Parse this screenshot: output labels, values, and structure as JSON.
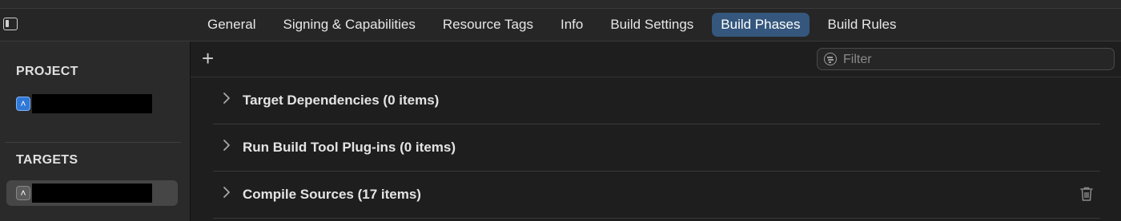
{
  "tabs": [
    {
      "label": "General"
    },
    {
      "label": "Signing & Capabilities"
    },
    {
      "label": "Resource Tags"
    },
    {
      "label": "Info"
    },
    {
      "label": "Build Settings"
    },
    {
      "label": "Build Phases",
      "active": true
    },
    {
      "label": "Build Rules"
    }
  ],
  "sidebar": {
    "project_header": "PROJECT",
    "targets_header": "TARGETS"
  },
  "toolbar": {
    "add_symbol": "+",
    "filter_placeholder": "Filter"
  },
  "phases": [
    {
      "label": "Target Dependencies (0 items)"
    },
    {
      "label": "Run Build Tool Plug-ins (0 items)"
    },
    {
      "label": "Compile Sources (17 items)"
    }
  ],
  "colors": {
    "active_tab": "#35577d",
    "background": "#1e1e1e",
    "sidebar": "#2a2a2a"
  }
}
